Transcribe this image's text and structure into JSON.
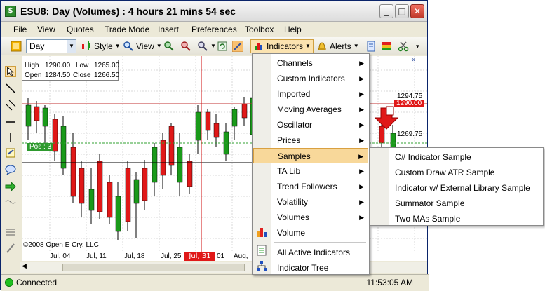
{
  "window": {
    "title": "ESU8: Day (Volumes) : 4 hours 21 mins 54 sec",
    "app_icon_glyph": "$",
    "min_glyph": "_",
    "max_glyph": "□",
    "close_glyph": "✕"
  },
  "menubar": [
    "File",
    "View",
    "Quotes",
    "Trade Mode",
    "Insert",
    "Preferences",
    "Toolbox",
    "Help"
  ],
  "toolbar": {
    "period": "Day",
    "style_label": "Style",
    "view_label": "View",
    "indicators_label": "Indicators",
    "alerts_label": "Alerts"
  },
  "info_box": {
    "high_label": "High",
    "high_value": "1290.00",
    "low_label": "Low",
    "low_value": "1265.00",
    "open_label": "Open",
    "open_value": "1284.50",
    "close_label": "Close",
    "close_value": "1266.50"
  },
  "chart": {
    "position_label": "Pos : 3",
    "copyright": "©2008 Open E Cry, LLC",
    "price_labels": [
      "1294.75",
      "1290.00",
      "1269.75"
    ],
    "date_labels": [
      "Jul, 04",
      "Jul, 11",
      "Jul, 18",
      "Jul, 25",
      "Jul, 31",
      "01",
      "Aug,"
    ],
    "colors": {
      "up": "#1a9a1a",
      "down": "#e01818",
      "cursor": "#d01010",
      "position_line": "#30a030"
    }
  },
  "chart_data": {
    "type": "candlestick",
    "x": [
      "Jul, 04",
      "Jul, 11",
      "Jul, 18",
      "Jul, 25",
      "Jul, 31",
      "Aug,"
    ],
    "y_labels": [
      "1294.75",
      "1290.00",
      "1269.75"
    ]
  },
  "indicators_menu": {
    "items": [
      {
        "label": "Channels",
        "submenu": true
      },
      {
        "label": "Custom Indicators",
        "submenu": true
      },
      {
        "label": "Imported",
        "submenu": true
      },
      {
        "label": "Moving Averages",
        "submenu": true
      },
      {
        "label": "Oscillator",
        "submenu": true
      },
      {
        "label": "Prices",
        "submenu": true
      },
      {
        "label": "Samples",
        "submenu": true
      },
      {
        "label": "TA Lib",
        "submenu": true
      },
      {
        "label": "Trend Followers",
        "submenu": true
      },
      {
        "label": "Volatility",
        "submenu": true
      },
      {
        "label": "Volumes",
        "submenu": true
      },
      {
        "label": "Volume",
        "submenu": false
      },
      {
        "label": "All Active Indicators",
        "submenu": false
      },
      {
        "label": "Indicator Tree",
        "submenu": false
      }
    ],
    "arrow_glyph": "▶"
  },
  "samples_menu": {
    "items": [
      "C# Indicator Sample",
      "Custom Draw ATR Sample",
      "Indicator w/ External Library Sample",
      "Summator Sample",
      "Two MAs Sample"
    ]
  },
  "status": {
    "connection": "Connected",
    "time": "11:53:05 AM"
  },
  "scroll": {
    "left_glyph": "◀"
  }
}
